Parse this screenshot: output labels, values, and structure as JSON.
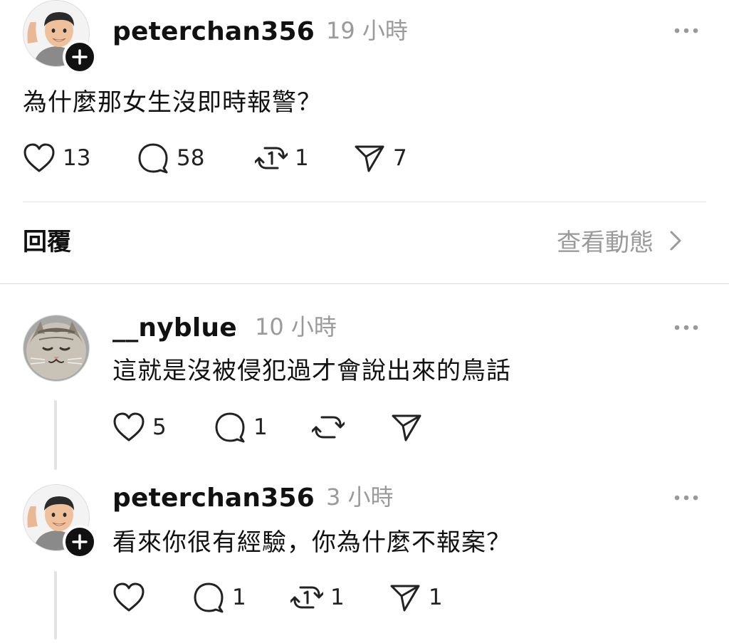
{
  "post": {
    "username": "peterchan356",
    "time": "19 小時",
    "text": "為什麼那女生沒即時報警？",
    "likes": "13",
    "comments": "58",
    "reposts": "1",
    "shares": "7"
  },
  "replies_section": {
    "title": "回覆",
    "activity_label": "查看動態"
  },
  "replies": [
    {
      "username": "__nyblue",
      "time": "10 小時",
      "text": "這就是沒被侵犯過才會說出來的鳥話",
      "likes": "5",
      "comments": "1",
      "reposts": "",
      "shares": ""
    },
    {
      "username": "peterchan356",
      "time": "3 小時",
      "text": "看來你很有經驗，你為什麼不報案？",
      "likes": "",
      "comments": "1",
      "reposts": "1",
      "shares": "1"
    }
  ],
  "icons": {
    "like": "heart-icon",
    "comment": "comment-bubble-icon",
    "repost": "repost-icon",
    "share": "send-icon",
    "more": "more-dots-icon",
    "follow": "plus-icon",
    "chevron": "chevron-right-icon"
  }
}
